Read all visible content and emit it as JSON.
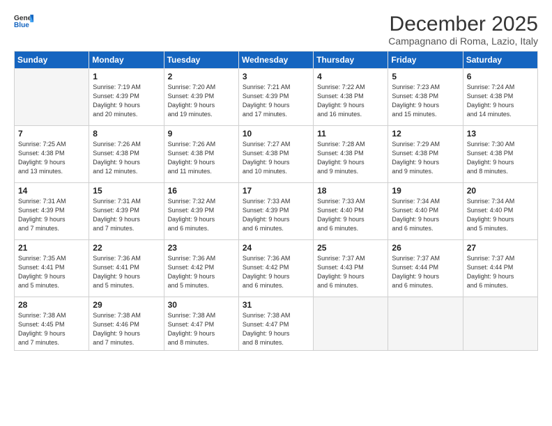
{
  "logo": {
    "line1": "General",
    "line2": "Blue"
  },
  "title": "December 2025",
  "location": "Campagnano di Roma, Lazio, Italy",
  "weekdays": [
    "Sunday",
    "Monday",
    "Tuesday",
    "Wednesday",
    "Thursday",
    "Friday",
    "Saturday"
  ],
  "weeks": [
    [
      {
        "day": "",
        "info": ""
      },
      {
        "day": "1",
        "info": "Sunrise: 7:19 AM\nSunset: 4:39 PM\nDaylight: 9 hours\nand 20 minutes."
      },
      {
        "day": "2",
        "info": "Sunrise: 7:20 AM\nSunset: 4:39 PM\nDaylight: 9 hours\nand 19 minutes."
      },
      {
        "day": "3",
        "info": "Sunrise: 7:21 AM\nSunset: 4:39 PM\nDaylight: 9 hours\nand 17 minutes."
      },
      {
        "day": "4",
        "info": "Sunrise: 7:22 AM\nSunset: 4:38 PM\nDaylight: 9 hours\nand 16 minutes."
      },
      {
        "day": "5",
        "info": "Sunrise: 7:23 AM\nSunset: 4:38 PM\nDaylight: 9 hours\nand 15 minutes."
      },
      {
        "day": "6",
        "info": "Sunrise: 7:24 AM\nSunset: 4:38 PM\nDaylight: 9 hours\nand 14 minutes."
      }
    ],
    [
      {
        "day": "7",
        "info": "Sunrise: 7:25 AM\nSunset: 4:38 PM\nDaylight: 9 hours\nand 13 minutes."
      },
      {
        "day": "8",
        "info": "Sunrise: 7:26 AM\nSunset: 4:38 PM\nDaylight: 9 hours\nand 12 minutes."
      },
      {
        "day": "9",
        "info": "Sunrise: 7:26 AM\nSunset: 4:38 PM\nDaylight: 9 hours\nand 11 minutes."
      },
      {
        "day": "10",
        "info": "Sunrise: 7:27 AM\nSunset: 4:38 PM\nDaylight: 9 hours\nand 10 minutes."
      },
      {
        "day": "11",
        "info": "Sunrise: 7:28 AM\nSunset: 4:38 PM\nDaylight: 9 hours\nand 9 minutes."
      },
      {
        "day": "12",
        "info": "Sunrise: 7:29 AM\nSunset: 4:38 PM\nDaylight: 9 hours\nand 9 minutes."
      },
      {
        "day": "13",
        "info": "Sunrise: 7:30 AM\nSunset: 4:38 PM\nDaylight: 9 hours\nand 8 minutes."
      }
    ],
    [
      {
        "day": "14",
        "info": "Sunrise: 7:31 AM\nSunset: 4:39 PM\nDaylight: 9 hours\nand 7 minutes."
      },
      {
        "day": "15",
        "info": "Sunrise: 7:31 AM\nSunset: 4:39 PM\nDaylight: 9 hours\nand 7 minutes."
      },
      {
        "day": "16",
        "info": "Sunrise: 7:32 AM\nSunset: 4:39 PM\nDaylight: 9 hours\nand 6 minutes."
      },
      {
        "day": "17",
        "info": "Sunrise: 7:33 AM\nSunset: 4:39 PM\nDaylight: 9 hours\nand 6 minutes."
      },
      {
        "day": "18",
        "info": "Sunrise: 7:33 AM\nSunset: 4:40 PM\nDaylight: 9 hours\nand 6 minutes."
      },
      {
        "day": "19",
        "info": "Sunrise: 7:34 AM\nSunset: 4:40 PM\nDaylight: 9 hours\nand 6 minutes."
      },
      {
        "day": "20",
        "info": "Sunrise: 7:34 AM\nSunset: 4:40 PM\nDaylight: 9 hours\nand 5 minutes."
      }
    ],
    [
      {
        "day": "21",
        "info": "Sunrise: 7:35 AM\nSunset: 4:41 PM\nDaylight: 9 hours\nand 5 minutes."
      },
      {
        "day": "22",
        "info": "Sunrise: 7:36 AM\nSunset: 4:41 PM\nDaylight: 9 hours\nand 5 minutes."
      },
      {
        "day": "23",
        "info": "Sunrise: 7:36 AM\nSunset: 4:42 PM\nDaylight: 9 hours\nand 5 minutes."
      },
      {
        "day": "24",
        "info": "Sunrise: 7:36 AM\nSunset: 4:42 PM\nDaylight: 9 hours\nand 6 minutes."
      },
      {
        "day": "25",
        "info": "Sunrise: 7:37 AM\nSunset: 4:43 PM\nDaylight: 9 hours\nand 6 minutes."
      },
      {
        "day": "26",
        "info": "Sunrise: 7:37 AM\nSunset: 4:44 PM\nDaylight: 9 hours\nand 6 minutes."
      },
      {
        "day": "27",
        "info": "Sunrise: 7:37 AM\nSunset: 4:44 PM\nDaylight: 9 hours\nand 6 minutes."
      }
    ],
    [
      {
        "day": "28",
        "info": "Sunrise: 7:38 AM\nSunset: 4:45 PM\nDaylight: 9 hours\nand 7 minutes."
      },
      {
        "day": "29",
        "info": "Sunrise: 7:38 AM\nSunset: 4:46 PM\nDaylight: 9 hours\nand 7 minutes."
      },
      {
        "day": "30",
        "info": "Sunrise: 7:38 AM\nSunset: 4:47 PM\nDaylight: 9 hours\nand 8 minutes."
      },
      {
        "day": "31",
        "info": "Sunrise: 7:38 AM\nSunset: 4:47 PM\nDaylight: 9 hours\nand 8 minutes."
      },
      {
        "day": "",
        "info": ""
      },
      {
        "day": "",
        "info": ""
      },
      {
        "day": "",
        "info": ""
      }
    ]
  ]
}
